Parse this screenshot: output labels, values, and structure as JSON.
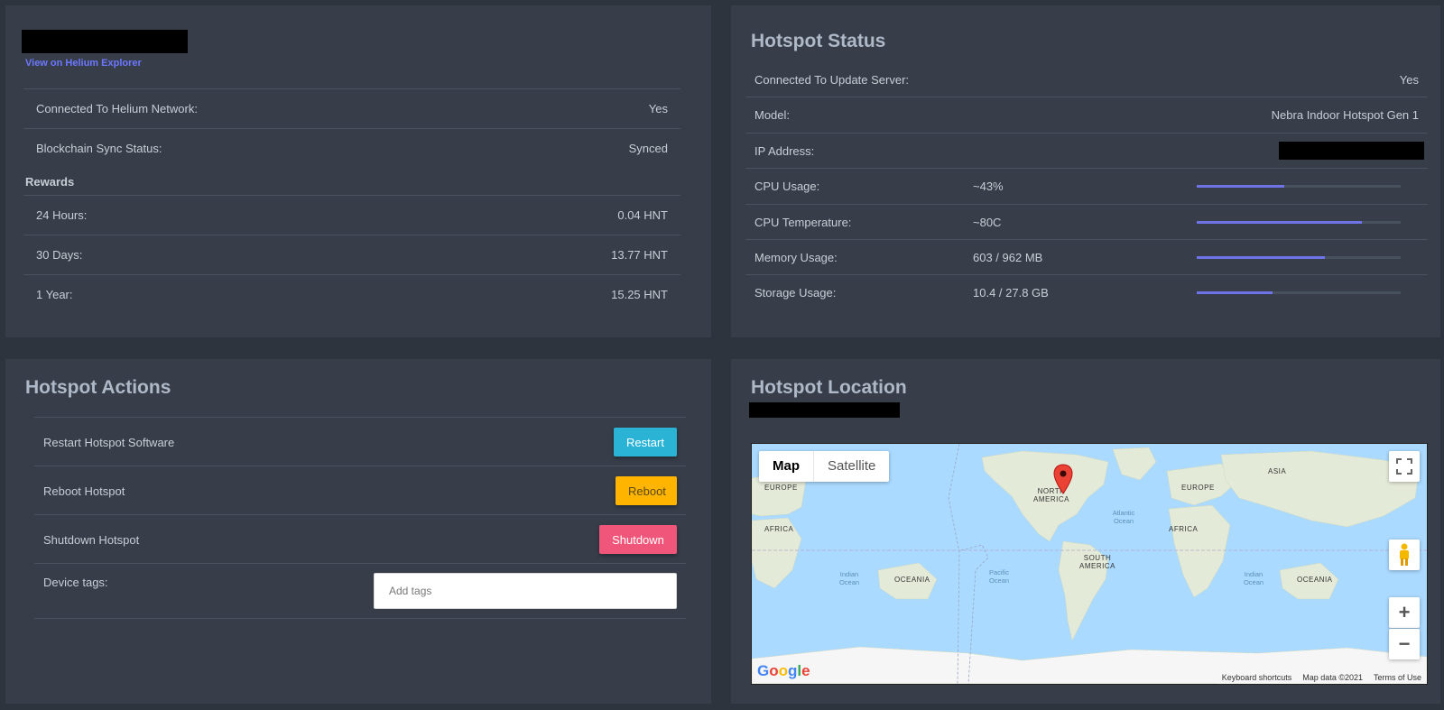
{
  "hotspot": {
    "explorer_link": "View on Helium Explorer",
    "rows": [
      {
        "label": "Connected To Helium Network:",
        "value": "Yes"
      },
      {
        "label": "Blockchain Sync Status:",
        "value": "Synced"
      }
    ],
    "rewards_heading": "Rewards",
    "rewards": [
      {
        "label": "24 Hours:",
        "value": "0.04 HNT"
      },
      {
        "label": "30 Days:",
        "value": "13.77 HNT"
      },
      {
        "label": "1 Year:",
        "value": "15.25 HNT"
      }
    ]
  },
  "status": {
    "title": "Hotspot Status",
    "rows": [
      {
        "label": "Connected To Update Server:",
        "value": "Yes"
      },
      {
        "label": "Model:",
        "value": "Nebra Indoor Hotspot Gen 1"
      },
      {
        "label": "IP Address:",
        "value": ""
      }
    ],
    "metrics": [
      {
        "label": "CPU Usage:",
        "value": "~43%",
        "level": 0.43
      },
      {
        "label": "CPU Temperature:",
        "value": "~80C",
        "level": 0.81
      },
      {
        "label": "Memory Usage:",
        "value": "603 / 962 MB",
        "level": 0.63
      },
      {
        "label": "Storage Usage:",
        "value": "10.4 / 27.8 GB",
        "level": 0.37
      }
    ],
    "accent_color": "#6f73e8"
  },
  "actions": {
    "title": "Hotspot Actions",
    "restart_label": "Restart Hotspot Software",
    "restart_button": "Restart",
    "reboot_label": "Reboot Hotspot",
    "reboot_button": "Reboot",
    "shutdown_label": "Shutdown Hotspot",
    "shutdown_button": "Shutdown",
    "tags_label": "Device tags:",
    "tags_placeholder": "Add tags",
    "colors": {
      "restart": "#2bb3d6",
      "reboot": "#ffb400",
      "shutdown": "#f0567a"
    }
  },
  "location": {
    "title": "Hotspot Location",
    "map": {
      "type_map": "Map",
      "type_satellite": "Satellite",
      "labels": [
        "EUROPE",
        "AFRICA",
        "NORTH AMERICA",
        "SOUTH AMERICA",
        "EUROPE",
        "AFRICA",
        "ASIA",
        "OCEANIA",
        "OCEANIA"
      ],
      "oceans": [
        "Atlantic Ocean",
        "Indian Ocean",
        "Pacific Ocean",
        "Indian Ocean"
      ],
      "google": "Google",
      "footer": [
        "Keyboard shortcuts",
        "Map data ©2021",
        "Terms of Use"
      ],
      "zoom_in": "+",
      "zoom_out": "−",
      "icons": [
        "fullscreen-icon",
        "pegman-icon",
        "map-pin-icon"
      ]
    }
  }
}
